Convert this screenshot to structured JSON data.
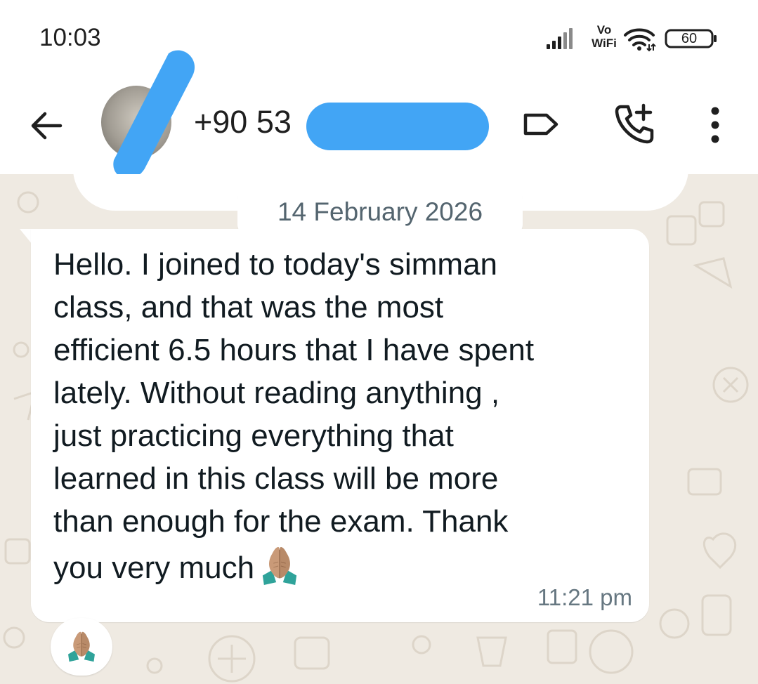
{
  "status_bar": {
    "time": "10:03",
    "network_label_top": "Vo",
    "network_label_bottom": "WiFi",
    "battery_level": "60",
    "icons": [
      "signal-icon",
      "wifi-icon",
      "battery-icon"
    ]
  },
  "header": {
    "contact_name": "+90 53",
    "icons": [
      "back-arrow-icon",
      "label-icon",
      "add-call-icon",
      "more-vert-icon"
    ]
  },
  "chat": {
    "date_separator": "14 February 2026",
    "message": {
      "text": "Hello. I joined to today's simman\nclass, and that was the most\nefficient 6.5 hours that I have spent\nlately. Without reading anything ,\njust practicing everything that\nlearned in this class will be more\nthan enough for the exam. Thank\nyou very much",
      "emoji": "folded-hands",
      "time": "11:21 pm"
    },
    "reaction": "folded-hands"
  },
  "colors": {
    "chat_background": "#efeae2",
    "bubble": "#ffffff",
    "redaction": "#42a5f5",
    "secondary_text": "#667781",
    "date_chip_text": "#54656f"
  }
}
